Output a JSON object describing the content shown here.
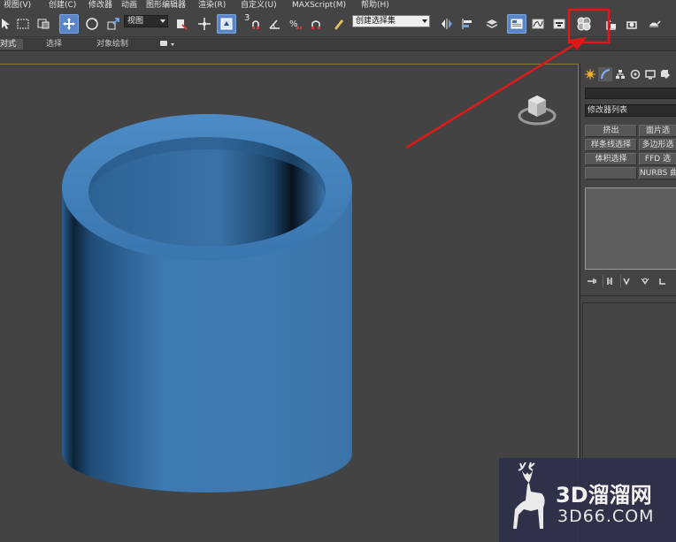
{
  "menu": {
    "items": [
      "视图(V)",
      "创建(C)",
      "修改器",
      "动画",
      "图形编辑器",
      "渲染(R)",
      "自定义(U)",
      "MAXScript(M)",
      "帮助(H)"
    ]
  },
  "toolbar": {
    "reference_coord_value": "视图",
    "named_selection_placeholder": "创建选择集",
    "snap_label": "3",
    "highlighted_tool": "material-editor-icon"
  },
  "ribbon": {
    "tabs": [
      "对式",
      "选择",
      "对象绘制"
    ]
  },
  "command_panel": {
    "modifier_list_label": "修改器列表",
    "buttons": [
      [
        "挤出",
        "面片选"
      ],
      [
        "样条线选择",
        "多边形选"
      ],
      [
        "体积选择",
        "FFD 选"
      ],
      [
        "",
        "NURBS 曲面"
      ]
    ]
  },
  "viewport": {
    "object": "tube",
    "object_color": "#3f7ab0"
  },
  "annotation": {
    "highlight_color": "#e01818"
  },
  "watermark": {
    "brand": "3D溜溜网",
    "url": "3D66.COM"
  }
}
